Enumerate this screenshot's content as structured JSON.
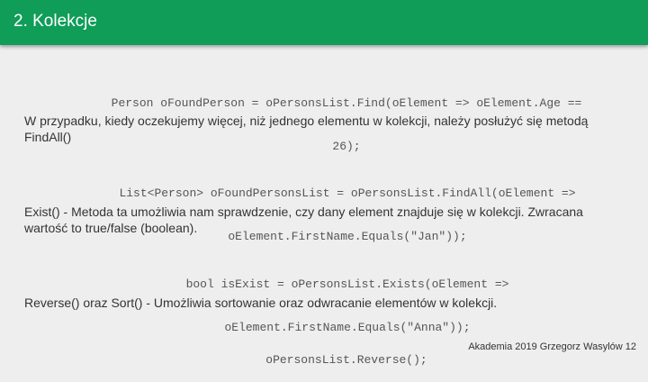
{
  "slide": {
    "title": "2. Kolekcje",
    "footer": "Akademia 2019 Grzegorz Wasylów 12"
  },
  "content": {
    "code1": {
      "line1": "Person oFoundPerson = oPersonsList.Find(oElement => oElement.Age ==",
      "line2": "26);"
    },
    "para1": "W przypadku, kiedy oczekujemy więcej, niż jednego elementu w kolekcji, należy posłużyć się metodą FindAll()",
    "code2": {
      "line1": "List<Person> oFoundPersonsList = oPersonsList.FindAll(oElement =>",
      "line2": "oElement.FirstName.Equals(\"Jan\"));"
    },
    "para2": "Exist() - Metoda ta umożliwia nam sprawdzenie, czy dany element znajduje się w kolekcji. Zwracana wartość to true/false (boolean).",
    "code3": {
      "line1": "bool isExist = oPersonsList.Exists(oElement =>",
      "line2": "oElement.FirstName.Equals(\"Anna\"));"
    },
    "para3": "Reverse() oraz Sort() - Umożliwia sortowanie oraz odwracanie elementów w kolekcji.",
    "code4": {
      "line1": "oPersonsList.Reverse();"
    }
  }
}
